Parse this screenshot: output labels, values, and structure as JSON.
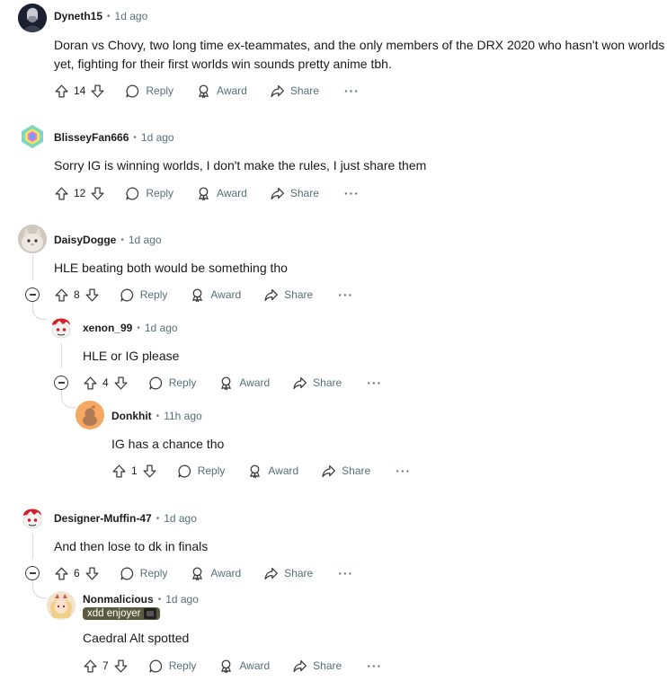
{
  "actions": {
    "reply": "Reply",
    "award": "Award",
    "share": "Share",
    "more": "···"
  },
  "flair_colors": {
    "bg": "#5b5a3e"
  },
  "comments": [
    {
      "username": "Dyneth15",
      "time": "1d ago",
      "text_lines": [
        "Doran vs Chovy, two long time ex-teammates, and the only members of the DRX 2020 who hasn't won worlds",
        "yet, fighting for their first worlds win sounds pretty anime tbh."
      ],
      "votes": "14",
      "avatar_icon": "dark-portrait-avatar"
    },
    {
      "username": "BlisseyFan666",
      "time": "1d ago",
      "text_lines": [
        "Sorry IG is winning worlds, I don't make the rules, I just share them"
      ],
      "votes": "12",
      "avatar_icon": "rainbow-gem-avatar"
    },
    {
      "username": "DaisyDogge",
      "time": "1d ago",
      "text_lines": [
        "HLE beating both would be something tho"
      ],
      "votes": "8",
      "avatar_icon": "cat-photo-avatar"
    },
    {
      "username": "xenon_99",
      "time": "1d ago",
      "text_lines": [
        "HLE or IG please"
      ],
      "votes": "4",
      "avatar_icon": "snoo-red-hair-avatar"
    },
    {
      "username": "Donkhit",
      "time": "11h ago",
      "text_lines": [
        "IG has a chance tho"
      ],
      "votes": "1",
      "avatar_icon": "default-snoo-avatar"
    },
    {
      "username": "Designer-Muffin-47",
      "time": "1d ago",
      "text_lines": [
        "And then lose to dk in finals"
      ],
      "votes": "6",
      "avatar_icon": "snoo-red-hair-avatar"
    },
    {
      "username": "Nonmalicious",
      "time": "1d ago",
      "flair": "xdd enjoyer",
      "text_lines": [
        "Caedral Alt spotted"
      ],
      "votes": "7",
      "avatar_icon": "anime-girl-avatar"
    }
  ]
}
